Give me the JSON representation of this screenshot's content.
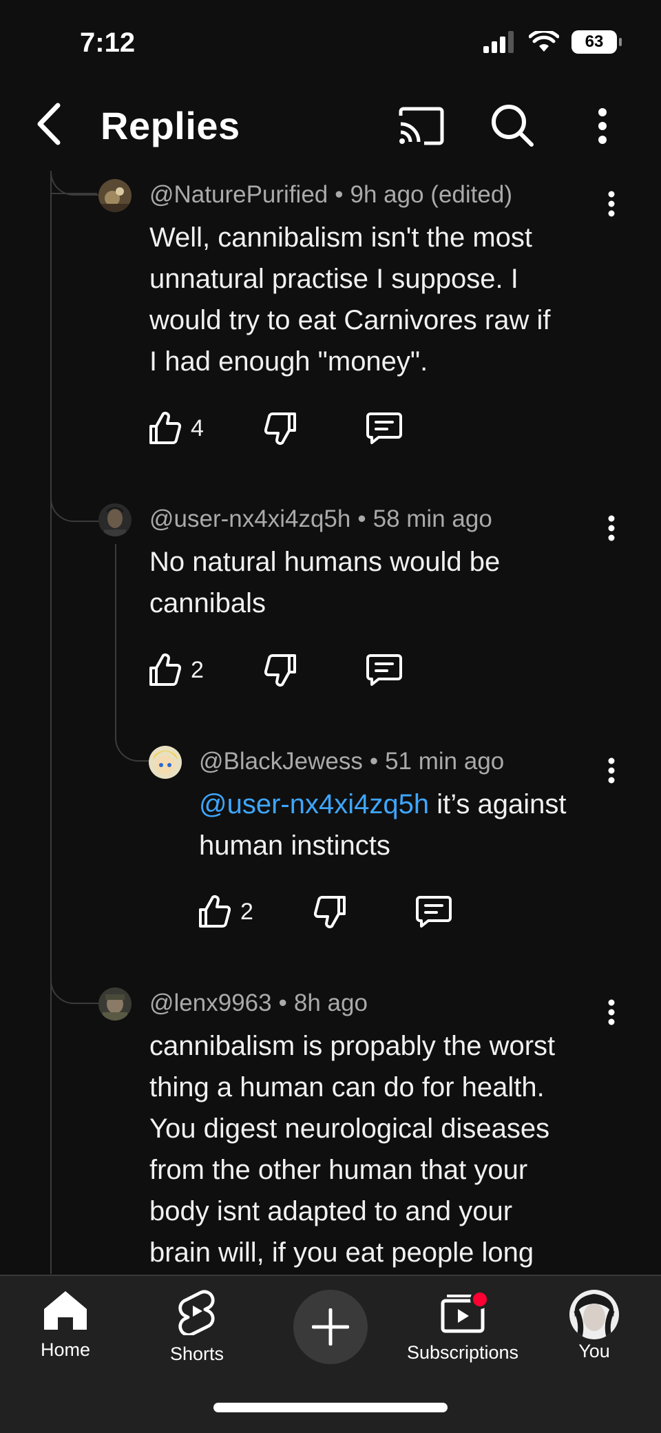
{
  "status_bar": {
    "time": "7:12",
    "battery": "63"
  },
  "header": {
    "title": "Replies"
  },
  "comments": [
    {
      "author": "@NaturePurified",
      "time": "9h ago (edited)",
      "lines": [
        "Well, cannibalism isn't the most",
        "unnatural practise I suppose. I",
        "would try to eat Carnivores raw if",
        "I had enough \"money\"."
      ],
      "likes": "4"
    },
    {
      "author": "@user-nx4xi4zq5h",
      "time": "58 min ago",
      "lines": [
        "No natural humans would be",
        "cannibals"
      ],
      "likes": "2"
    },
    {
      "author": "@BlackJewess",
      "time": "51 min ago",
      "mention": "@user-nx4xi4zq5h",
      "line1_rest": " it’s against",
      "line2": "human instincts",
      "likes": "2"
    },
    {
      "author": "@lenx9963",
      "time": "8h ago",
      "lines": [
        "cannibalism is propably the worst",
        "thing a human can do for health.",
        "You digest neurological diseases",
        "from the other human that your",
        "body isnt adapted to and your",
        "brain will, if you eat people long"
      ]
    }
  ],
  "separator": "•",
  "bottom_nav": {
    "items": [
      {
        "label": "Home",
        "icon": "home-icon"
      },
      {
        "label": "Shorts",
        "icon": "shorts-icon"
      },
      {
        "label": "Subscriptions",
        "icon": "subscriptions-icon"
      },
      {
        "label": "You",
        "icon": "avatar"
      }
    ]
  },
  "colors": {
    "background": "#0f0f0f",
    "mention": "#3ea6ff",
    "meta": "#aaaaaa",
    "notification": "#ff0033"
  }
}
